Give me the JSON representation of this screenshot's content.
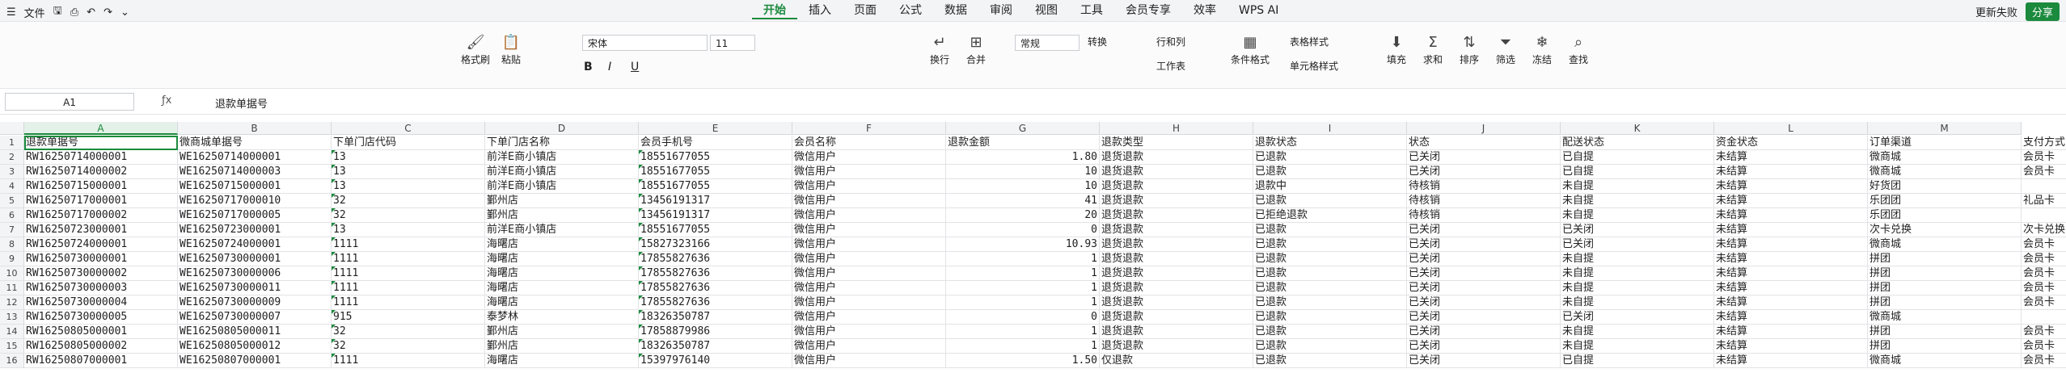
{
  "menubar": {
    "file_label": "文件",
    "tabs": [
      "开始",
      "插入",
      "页面",
      "公式",
      "数据",
      "审阅",
      "视图",
      "工具",
      "会员专享",
      "效率",
      "WPS AI"
    ],
    "active_tab": "开始",
    "update_label": "更新失败",
    "share_label": "分享"
  },
  "ribbon": {
    "format_painter": "格式刷",
    "paste": "粘贴",
    "font_name": "宋体",
    "font_size": "11",
    "wrap": "换行",
    "merge": "合并",
    "number_format": "常规",
    "convert": "转换",
    "row_col": "行和列",
    "worksheet": "工作表",
    "conditional": "条件格式",
    "table_style": "表格样式",
    "cell_style": "单元格样式",
    "fill": "填充",
    "sum": "求和",
    "sort": "排序",
    "filter": "筛选",
    "freeze": "冻结",
    "find": "查找"
  },
  "formula": {
    "cell_ref": "A1",
    "content": "退款单据号"
  },
  "sheet": {
    "col_letters": [
      "A",
      "B",
      "C",
      "D",
      "E",
      "F",
      "G",
      "H",
      "I",
      "J",
      "K",
      "L",
      "M"
    ],
    "headers": [
      "退款单据号",
      "微商城单据号",
      "下单门店代码",
      "下单门店名称",
      "会员手机号",
      "会员名称",
      "退款金额",
      "退款类型",
      "退款状态",
      "状态",
      "配送状态",
      "资金状态",
      "订单渠道",
      "支付方式"
    ],
    "rows": [
      [
        "RW16250714000001",
        "WE16250714000001",
        "13",
        "前洋E商小镇店",
        "18551677055",
        "微信用户",
        "1.80",
        "退货退款",
        "已退款",
        "已关闭",
        "已自提",
        "未结算",
        "微商城",
        "会员卡"
      ],
      [
        "RW16250714000002",
        "WE16250714000003",
        "13",
        "前洋E商小镇店",
        "18551677055",
        "微信用户",
        "10",
        "退货退款",
        "已退款",
        "已关闭",
        "已自提",
        "未结算",
        "微商城",
        "会员卡"
      ],
      [
        "RW16250715000001",
        "WE16250715000001",
        "13",
        "前洋E商小镇店",
        "18551677055",
        "微信用户",
        "10",
        "退货退款",
        "退款中",
        "待核销",
        "未自提",
        "未结算",
        "好货团",
        ""
      ],
      [
        "RW16250717000001",
        "WE16250717000010",
        "32",
        "鄞州店",
        "13456191317",
        "微信用户",
        "41",
        "退货退款",
        "已退款",
        "待核销",
        "未自提",
        "未结算",
        "乐团团",
        "礼品卡"
      ],
      [
        "RW16250717000002",
        "WE16250717000005",
        "32",
        "鄞州店",
        "13456191317",
        "微信用户",
        "20",
        "退货退款",
        "已拒绝退款",
        "待核销",
        "未自提",
        "未结算",
        "乐团团",
        ""
      ],
      [
        "RW16250723000001",
        "WE16250723000001",
        "13",
        "前洋E商小镇店",
        "18551677055",
        "微信用户",
        "0",
        "退货退款",
        "已退款",
        "已关闭",
        "已关闭",
        "未结算",
        "次卡兑换",
        "次卡兑换"
      ],
      [
        "RW16250724000001",
        "WE16250724000001",
        "1111",
        "海曙店",
        "15827323166",
        "微信用户",
        "10.93",
        "退货退款",
        "已退款",
        "已关闭",
        "已关闭",
        "未结算",
        "微商城",
        "会员卡"
      ],
      [
        "RW16250730000001",
        "WE16250730000001",
        "1111",
        "海曙店",
        "17855827636",
        "微信用户",
        "1",
        "退货退款",
        "已退款",
        "已关闭",
        "未自提",
        "未结算",
        "拼团",
        "会员卡"
      ],
      [
        "RW16250730000002",
        "WE16250730000006",
        "1111",
        "海曙店",
        "17855827636",
        "微信用户",
        "1",
        "退货退款",
        "已退款",
        "已关闭",
        "未自提",
        "未结算",
        "拼团",
        "会员卡"
      ],
      [
        "RW16250730000003",
        "WE16250730000011",
        "1111",
        "海曙店",
        "17855827636",
        "微信用户",
        "1",
        "退货退款",
        "已退款",
        "已关闭",
        "未自提",
        "未结算",
        "拼团",
        "会员卡"
      ],
      [
        "RW16250730000004",
        "WE16250730000009",
        "1111",
        "海曙店",
        "17855827636",
        "微信用户",
        "1",
        "退货退款",
        "已退款",
        "已关闭",
        "未自提",
        "未结算",
        "拼团",
        "会员卡"
      ],
      [
        "RW16250730000005",
        "WE16250730000007",
        "915",
        "泰梦林",
        "18326350787",
        "微信用户",
        "0",
        "退货退款",
        "已退款",
        "已关闭",
        "已关闭",
        "未结算",
        "微商城",
        ""
      ],
      [
        "RW16250805000001",
        "WE16250805000011",
        "32",
        "鄞州店",
        "17858879986",
        "微信用户",
        "1",
        "退货退款",
        "已退款",
        "已关闭",
        "未自提",
        "未结算",
        "拼团",
        "会员卡"
      ],
      [
        "RW16250805000002",
        "WE16250805000012",
        "32",
        "鄞州店",
        "18326350787",
        "微信用户",
        "1",
        "退货退款",
        "已退款",
        "已关闭",
        "未自提",
        "未结算",
        "拼团",
        "会员卡"
      ],
      [
        "RW16250807000001",
        "WE16250807000001",
        "1111",
        "海曙店",
        "15397976140",
        "微信用户",
        "1.50",
        "仅退款",
        "已退款",
        "已关闭",
        "已自提",
        "未结算",
        "微商城",
        "会员卡"
      ]
    ]
  }
}
